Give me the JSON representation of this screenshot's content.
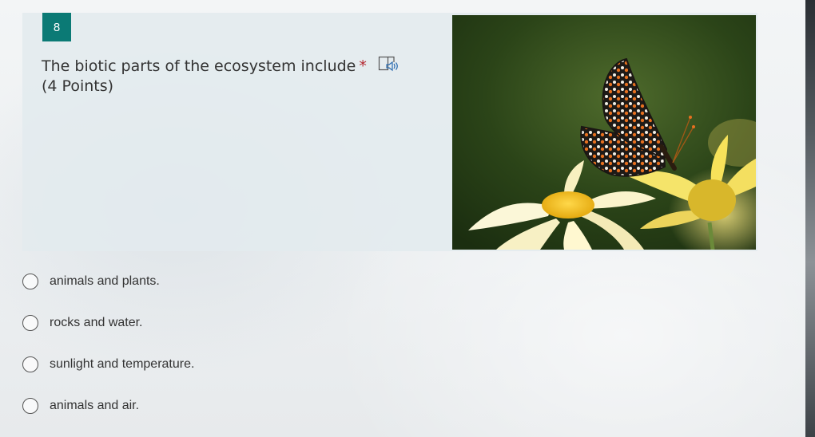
{
  "question": {
    "number": "8",
    "title": "The biotic parts of the ecosystem include",
    "required_mark": "*",
    "points": "(4 Points)",
    "speaker_icon": "immersive-reader-icon",
    "image_alt": "butterfly-on-daisy-photo"
  },
  "options": [
    {
      "label": "animals and plants."
    },
    {
      "label": "rocks and water."
    },
    {
      "label": "sunlight and temperature."
    },
    {
      "label": "animals and air."
    }
  ],
  "colors": {
    "number_badge": "#0b7a75",
    "required": "#b4262f",
    "card": "#e2eaee"
  }
}
